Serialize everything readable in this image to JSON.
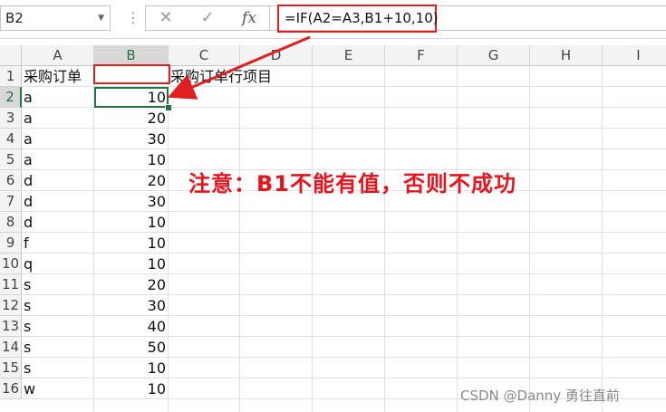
{
  "formula_bar": {
    "name_box": "B2",
    "dropdown_glyph": "▼",
    "more_glyph": "⋮",
    "cancel_glyph": "✕",
    "enter_glyph": "✓",
    "fx_label": "fx",
    "formula": "=IF(A2=A3,B1+10,10)"
  },
  "columns": [
    "A",
    "B",
    "C",
    "D",
    "E",
    "F",
    "G",
    "H",
    "I"
  ],
  "selected_column": "B",
  "selected_row": "2",
  "rows": [
    {
      "num": "1",
      "a": "采购订单",
      "b": "",
      "c": "采购订单行项目"
    },
    {
      "num": "2",
      "a": "a",
      "b": "10"
    },
    {
      "num": "3",
      "a": "a",
      "b": "20"
    },
    {
      "num": "4",
      "a": "a",
      "b": "30"
    },
    {
      "num": "5",
      "a": "a",
      "b": "10"
    },
    {
      "num": "6",
      "a": "d",
      "b": "20"
    },
    {
      "num": "7",
      "a": "d",
      "b": "30"
    },
    {
      "num": "8",
      "a": "d",
      "b": "10"
    },
    {
      "num": "9",
      "a": "f",
      "b": "10"
    },
    {
      "num": "10",
      "a": "q",
      "b": "10"
    },
    {
      "num": "11",
      "a": "s",
      "b": "20"
    },
    {
      "num": "12",
      "a": "s",
      "b": "30"
    },
    {
      "num": "13",
      "a": "s",
      "b": "40"
    },
    {
      "num": "14",
      "a": "s",
      "b": "50"
    },
    {
      "num": "15",
      "a": "s",
      "b": "10"
    },
    {
      "num": "16",
      "a": "w",
      "b": "10"
    }
  ],
  "annotation": {
    "note": "注意：B1不能有值，否则不成功",
    "color": "#e8141d"
  },
  "watermark": "CSDN @Danny 勇往直前",
  "colors": {
    "selection": "#217346",
    "highlight": "#e02020"
  }
}
